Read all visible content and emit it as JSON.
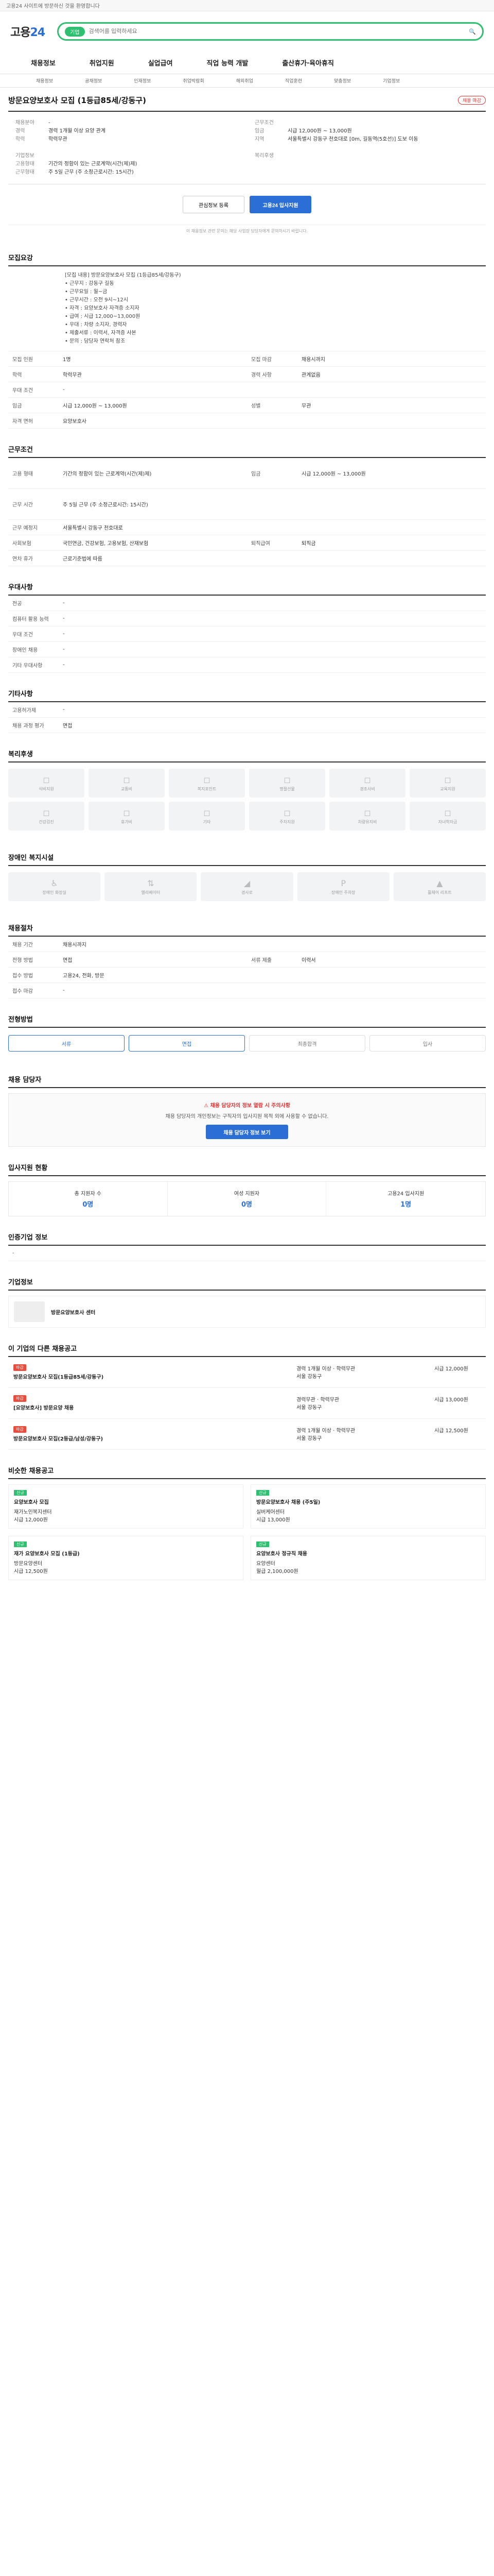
{
  "topbar": {
    "text": "고용24 사이트에 방문하신 것을 환영합니다"
  },
  "header": {
    "logo_a": "고용",
    "logo_b": "24",
    "search_tag": "기업",
    "search_placeholder": "검색어를 입력하세요"
  },
  "gnb": [
    "채용정보",
    "취업지원",
    "실업급여",
    "직업 능력 개발",
    "출산휴가·육아휴직"
  ],
  "subnav": [
    "채용정보",
    "공채정보",
    "인재정보",
    "취업박람회",
    "해외취업",
    "직업훈련",
    "맞춤정보",
    "기업정보"
  ],
  "job": {
    "title": "방문요양보호사 모집 (1등급85세/강동구)",
    "status": "채용 마감",
    "summary_left": [
      {
        "k": "채용분야",
        "v": "-"
      },
      {
        "k": "경력",
        "v": "경력 1개월 이상 요양 관계"
      },
      {
        "k": "학력",
        "v": "학력무관"
      }
    ],
    "summary_right": [
      {
        "k": "근무조건",
        "v": ""
      },
      {
        "k": "임금",
        "v": "시급 12,000원 ~ 13,000원"
      },
      {
        "k": "지역",
        "v": "서울특별시 강동구 천호대로 [0m, 길동역(5호선)] 도보 이동"
      }
    ],
    "company_label": "기업정보",
    "company_rows": [
      {
        "k": "고용형태",
        "v": "기간의 정함이 있는 근로계약(시간(제)제)"
      },
      {
        "k": "근무형태",
        "v": "주 5일 근무 (주 소정근로시간: 15시간)"
      }
    ],
    "benefit_label": "복리후생",
    "btn_scrap": "관심정보 등록",
    "btn_apply": "고용24 입사지원",
    "note": "이 채용정보 관련 문의는 해당 사업장 담당자에게 문의하시기 바랍니다."
  },
  "sections": {
    "s1_title": "모집요강",
    "s1_body": "[모집 내용] 방문요양보호사 모집 (1등급85세/강동구)\n• 근무지 : 강동구 길동\n• 근무요일 : 월~금 \n• 근무시간 : 오전 9시~12시\n• 자격 : 요양보호사 자격증 소지자\n• 급여 : 시급 12,000~13,000원\n• 우대 : 차량 소지자, 경력자\n• 제출서류 : 이력서, 자격증 사본\n• 문의 : 담당자 연락처 참조",
    "rows1": [
      {
        "h1": "모집 인원",
        "v1": "1명",
        "h2": "모집 마감",
        "v2": "채용시까지"
      },
      {
        "h1": "학력",
        "v1": "학력무관",
        "h2": "경력 사항",
        "v2": "관계없음"
      },
      {
        "h1": "우대 조건",
        "v1": "-",
        "h2": "",
        "v2": ""
      },
      {
        "h1": "임금",
        "v1": "시급 12,000원 ~ 13,000원",
        "h2": "성별",
        "v2": "무관"
      },
      {
        "h1": "자격 면허",
        "v1": "요양보호사",
        "h2": "",
        "v2": ""
      }
    ],
    "s2_title": "근무조건",
    "rows2": [
      {
        "h1": "고용 형태",
        "v1": "기간의 정함이 있는 근로계약(시간(제)제)",
        "h2": "임금",
        "v2": "시급 12,000원 ~ 13,000원"
      },
      {
        "h1": "근무 시간",
        "v1": "주 5일 근무 (주 소정근로시간: 15시간)",
        "h2": "",
        "v2": ""
      },
      {
        "h1": "근무 예정지",
        "v1": "서울특별시 강동구 천호대로",
        "h2": "",
        "v2": ""
      },
      {
        "h1": "사회보험",
        "v1": "국민연금, 건강보험, 고용보험, 산재보험",
        "h2": "퇴직급여",
        "v2": "퇴직금"
      },
      {
        "h1": "연차 휴가",
        "v1": "근로기준법에 따름",
        "h2": "",
        "v2": ""
      }
    ],
    "s3_title": "우대사항",
    "rows3": [
      {
        "h1": "전공",
        "v1": "-"
      },
      {
        "h1": "컴퓨터 활용 능력",
        "v1": "-"
      },
      {
        "h1": "우대 조건",
        "v1": "-"
      },
      {
        "h1": "장애인 채용",
        "v1": "-"
      },
      {
        "h1": "기타 우대사항",
        "v1": "-"
      }
    ],
    "s4_title": "기타사항",
    "rows4": [
      {
        "h1": "고용허가제",
        "v1": "-"
      },
      {
        "h1": "채용 과정 평가",
        "v1": "면접"
      }
    ],
    "s5_title": "복리후생",
    "benefits": [
      "식비지원",
      "교통비",
      "복지포인트",
      "명절선물",
      "경조사비",
      "교육지원",
      "건강검진",
      "휴가비",
      "기타",
      "주차지원",
      "차량유지비",
      "자녀학자금"
    ],
    "s6_title": "장애인 복지시설",
    "facilities": [
      "장애인 화장실",
      "엘리베이터",
      "경사로",
      "장애인 주차장",
      "휠체어 리프트"
    ],
    "s7_title": "채용절차",
    "rows7": [
      {
        "h1": "채용 기간",
        "v1": "채용시까지"
      },
      {
        "h1": "전형 방법",
        "v1": "면접",
        "h2": "서류 제출",
        "v2": "이력서"
      },
      {
        "h1": "접수 방법",
        "v1": "고용24, 전화, 방문"
      },
      {
        "h1": "접수 마감",
        "v1": "-"
      }
    ],
    "s8_title": "전형방법",
    "steps": [
      "서류",
      "면접",
      "최종합격",
      "입사"
    ],
    "s9_title": "채용 담당자",
    "notice": "채용 담당자의 정보 열람 시 주의사항",
    "notice_body": "채용 담당자의 개인정보는 구직자의 입사지원 목적 외에 사용할 수 없습니다.",
    "btn_contact": "채용 담당자 정보 보기",
    "s10_title": "입사지원 현황",
    "stats": [
      {
        "k": "총 지원자 수",
        "v": "0명"
      },
      {
        "k": "여성 지원자",
        "v": "0명"
      },
      {
        "k": "고용24 입사지원",
        "v": "1명"
      }
    ],
    "s11_title": "인증기업 정보",
    "s12_title": "기업정보",
    "company_name": "방문요양보호사 센터",
    "s13_title": "이 기업의 다른 채용공고",
    "other_jobs": [
      {
        "badge": "마감",
        "title": "방문요양보호사 모집(1등급85세/강동구)",
        "info": "경력 1개월 이상 · 학력무관",
        "loc": "서울 강동구",
        "pay": "시급 12,000원"
      },
      {
        "badge": "마감",
        "title": "[요양보호사] 방문요양 채용",
        "info": "경력무관 · 학력무관",
        "loc": "서울 강동구",
        "pay": "시급 13,000원"
      },
      {
        "badge": "마감",
        "title": "방문요양보호사 모집(2등급/남성/강동구)",
        "info": "경력 1개월 이상 · 학력무관",
        "loc": "서울 강동구",
        "pay": "시급 12,500원"
      }
    ],
    "s14_title": "비슷한 채용공고",
    "similar": [
      {
        "badge": "신규",
        "title": "요양보호사 모집",
        "org": "재가노인복지센터",
        "pay": "시급 12,000원"
      },
      {
        "badge": "신규",
        "title": "방문요양보호사 채용 (주5일)",
        "org": "실버케어센터",
        "pay": "시급 13,000원"
      },
      {
        "badge": "신규",
        "title": "재가 요양보호사 모집 (1등급)",
        "org": "방문요양센터",
        "pay": "시급 12,500원"
      },
      {
        "badge": "신규",
        "title": "요양보호사 정규직 채용",
        "org": "요양센터",
        "pay": "월급 2,100,000원"
      }
    ]
  }
}
